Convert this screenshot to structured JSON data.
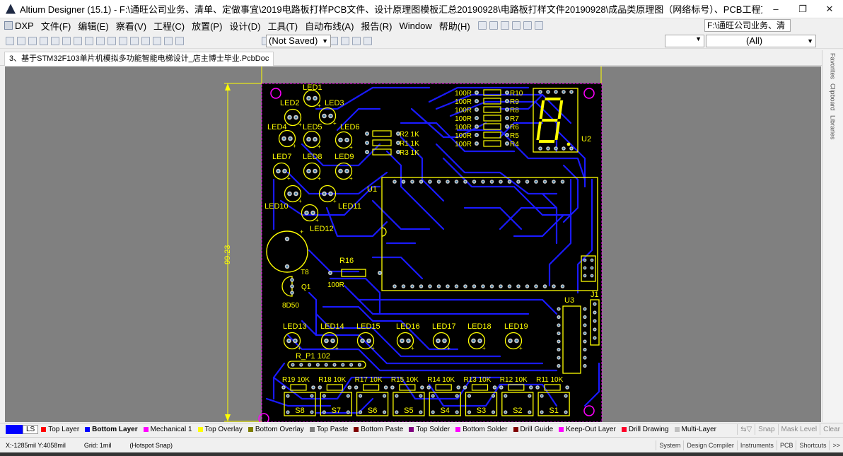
{
  "window": {
    "title": "Altium Designer (15.1) - F:\\通旺公司业务、清单、定做事宜\\2019电路板打样PCB文件、设计原理图模板汇总20190928\\电路板打样文件20190928\\成品类原理图（网络标号）、PCB工程文...",
    "min": "–",
    "restore": "❐",
    "close": "✕"
  },
  "menu": {
    "dxp": "DXP",
    "items": [
      "文件(F)",
      "编辑(E)",
      "察看(V)",
      "工程(C)",
      "放置(P)",
      "设计(D)",
      "工具(T)",
      "自动布线(A)",
      "报告(R)",
      "Window",
      "帮助(H)"
    ],
    "path": "F:\\通旺公司业务、清"
  },
  "toolbar": {
    "save_state": "(Not Saved)",
    "filter_all": "(All)"
  },
  "document": {
    "tab": "3、基于STM32F103单片机模拟多功能智能电梯设计_店主博士毕业.PcbDoc"
  },
  "sidebar": [
    "Favorites",
    "Clipboard",
    "Libraries"
  ],
  "pcb": {
    "dimension": "99.23",
    "components": {
      "leds_top": [
        "LED1",
        "LED2",
        "LED3",
        "LED4",
        "LED5",
        "LED6",
        "LED7",
        "LED8",
        "LED9",
        "LED10",
        "LED11",
        "LED12"
      ],
      "leds_bottom": [
        "LED13",
        "LED14",
        "LED15",
        "LED16",
        "LED17",
        "LED18",
        "LED19"
      ],
      "res_small": [
        {
          "ref": "R2",
          "value": "1K"
        },
        {
          "ref": "R1",
          "value": "1K"
        },
        {
          "ref": "R3",
          "value": "1K"
        }
      ],
      "res_right": [
        {
          "ref": "R10",
          "value": "100R"
        },
        {
          "ref": "R9",
          "value": "100R"
        },
        {
          "ref": "R8",
          "value": "100R"
        },
        {
          "ref": "R7",
          "value": "100R"
        },
        {
          "ref": "R6",
          "value": "100R"
        },
        {
          "ref": "R5",
          "value": "100R"
        },
        {
          "ref": "R4",
          "value": "100R"
        }
      ],
      "res_row": [
        {
          "ref": "R19",
          "value": "10K"
        },
        {
          "ref": "R18",
          "value": "10K"
        },
        {
          "ref": "R17",
          "value": "10K"
        },
        {
          "ref": "R15",
          "value": "10K"
        },
        {
          "ref": "R14",
          "value": "10K"
        },
        {
          "ref": "R13",
          "value": "10K"
        },
        {
          "ref": "R12",
          "value": "10K"
        },
        {
          "ref": "R11",
          "value": "10K"
        }
      ],
      "switches": [
        "S8",
        "S7",
        "S6",
        "S5",
        "S4",
        "S3",
        "S2",
        "S1"
      ],
      "u1": "U1",
      "u2": "U2",
      "u3": "U3",
      "j1": "J1",
      "r16": "R16",
      "r16_value": "100R",
      "q1": "Q1",
      "q1_value": "8D50",
      "t8": "T8",
      "rp1": "R_P1",
      "rp1_value": "102"
    }
  },
  "layers": {
    "current": "LS",
    "tabs": [
      {
        "name": "Top Layer",
        "color": "#ff0000"
      },
      {
        "name": "Bottom Layer",
        "color": "#0000ff",
        "selected": true
      },
      {
        "name": "Mechanical 1",
        "color": "#ff00ff"
      },
      {
        "name": "Top Overlay",
        "color": "#ffff00"
      },
      {
        "name": "Bottom Overlay",
        "color": "#808000"
      },
      {
        "name": "Top Paste",
        "color": "#808080"
      },
      {
        "name": "Bottom Paste",
        "color": "#800000"
      },
      {
        "name": "Top Solder",
        "color": "#800080"
      },
      {
        "name": "Bottom Solder",
        "color": "#ff00ff"
      },
      {
        "name": "Drill Guide",
        "color": "#800000"
      },
      {
        "name": "Keep-Out Layer",
        "color": "#ff00ff"
      },
      {
        "name": "Drill Drawing",
        "color": "#ff002a"
      },
      {
        "name": "Multi-Layer",
        "color": "#c0c0c0"
      }
    ],
    "snap": "Snap",
    "mask": "Mask Level",
    "clear": "Clear"
  },
  "status": {
    "coords": "X:-1285mil Y:4058mil",
    "grid": "Grid: 1mil",
    "snap": "(Hotspot Snap)",
    "panels": [
      "System",
      "Design Compiler",
      "Instruments",
      "PCB",
      "Shortcuts"
    ]
  },
  "colors": {
    "board": "#000000",
    "trace": "#1a1aff",
    "silk": "#ffff00",
    "pad": "#c8c8c8",
    "via_hole": "#3a7ea8",
    "workspace": "#808080"
  }
}
